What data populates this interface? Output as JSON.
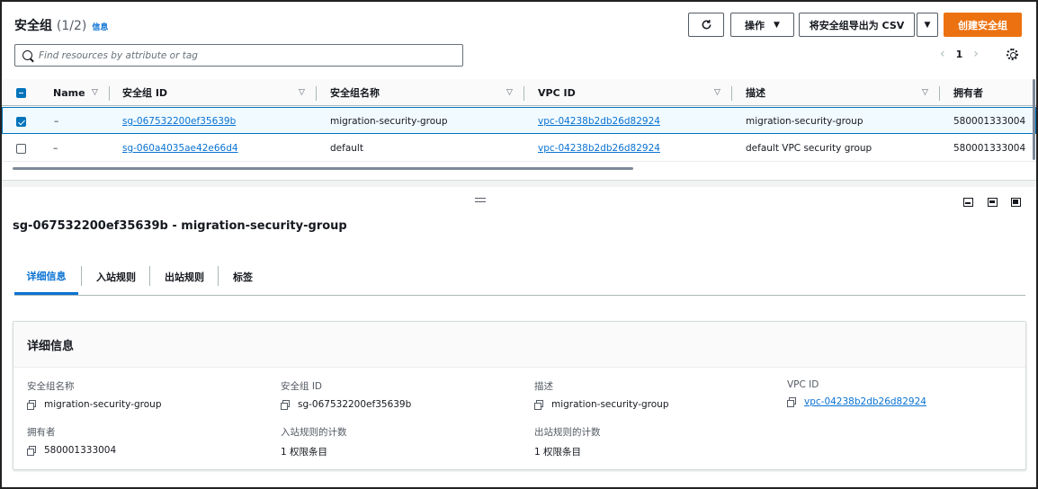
{
  "header": {
    "title": "安全组",
    "count": "(1/2)",
    "info_label": "信息"
  },
  "toolbar": {
    "actions_label": "操作",
    "export_label": "将安全组导出为 CSV",
    "create_label": "创建安全组"
  },
  "search": {
    "placeholder": "Find resources by attribute or tag"
  },
  "pagination": {
    "current_page": "1"
  },
  "table": {
    "columns": [
      "Name",
      "安全组 ID",
      "安全组名称",
      "VPC ID",
      "描述",
      "拥有者"
    ],
    "rows": [
      {
        "selected": true,
        "name": "–",
        "sg_id": "sg-067532200ef35639b",
        "sg_name": "migration-security-group",
        "vpc_id": "vpc-04238b2db26d82924",
        "description": "migration-security-group",
        "owner": "580001333004"
      },
      {
        "selected": false,
        "name": "–",
        "sg_id": "sg-060a4035ae42e66d4",
        "sg_name": "default",
        "vpc_id": "vpc-04238b2db26d82924",
        "description": "default VPC security group",
        "owner": "580001333004"
      }
    ]
  },
  "detail": {
    "title": "sg-067532200ef35639b - migration-security-group",
    "tabs": [
      "详细信息",
      "入站规则",
      "出站规则",
      "标签"
    ],
    "active_tab": "详细信息",
    "card_title": "详细信息",
    "fields": {
      "sg_name_label": "安全组名称",
      "sg_name_value": "migration-security-group",
      "sg_id_label": "安全组 ID",
      "sg_id_value": "sg-067532200ef35639b",
      "desc_label": "描述",
      "desc_value": "migration-security-group",
      "vpc_label": "VPC ID",
      "vpc_value": "vpc-04238b2db26d82924",
      "owner_label": "拥有者",
      "owner_value": "580001333004",
      "inbound_label": "入站规则的计数",
      "inbound_value": "1 权限条目",
      "outbound_label": "出站规则的计数",
      "outbound_value": "1 权限条目"
    }
  },
  "colors": {
    "primary": "#ec7211",
    "link": "#0972d3",
    "selected_row_bg": "#f1faff",
    "selected_row_border": "#0073bb"
  },
  "icons": [
    "refresh-icon",
    "caret-down-icon",
    "search-icon",
    "chevron-left-icon",
    "chevron-right-icon",
    "settings-gear-icon",
    "copy-icon",
    "drag-handle-icon",
    "panel-layout-icon"
  ]
}
